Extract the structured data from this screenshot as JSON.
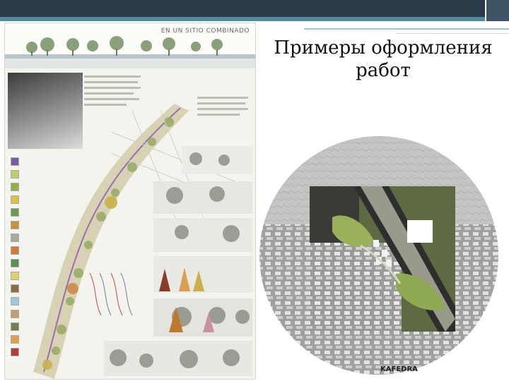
{
  "slide": {
    "title": "Примеры оформления работ"
  },
  "poster": {
    "header_title": "EN UN SITIO COMBINADO",
    "legend_colors": [
      "#7a5aa0",
      "#b9d06a",
      "#8fb04c",
      "#d9c34a",
      "#6f9a55",
      "#c7923a",
      "#a8a8a8",
      "#d07a3a",
      "#5b8f57",
      "#e0d070",
      "#8c6b4a",
      "#9cc8d8",
      "#c0a070",
      "#708050",
      "#e0a050",
      "#b04040"
    ]
  },
  "map": {
    "logo_text": "KAFEDRA"
  },
  "colors": {
    "topbar": "#2b3a48",
    "accent": "#4f8a9a",
    "rule": "#a9c3cc"
  }
}
